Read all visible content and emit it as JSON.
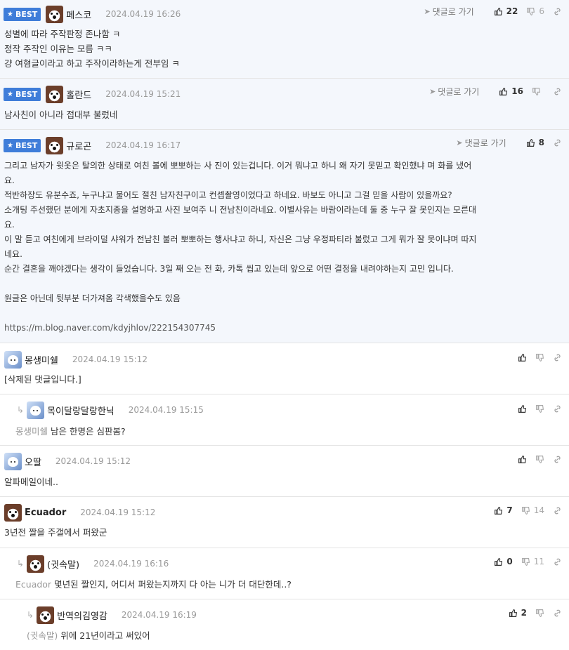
{
  "labels": {
    "best": "BEST",
    "reply_go": "댓글로 가기"
  },
  "comments": [
    {
      "nick": "페스코",
      "date": "2024.04.19 16:26",
      "up": "22",
      "down": "6",
      "lines": [
        "성별에 따라 주작판정 존나함 ㅋ",
        "정작 주작인 이유는 모름 ㅋㅋ",
        "걍 여혐글이라고 하고 주작이라하는게 전부임 ㅋ"
      ]
    },
    {
      "nick": "홀란드",
      "date": "2024.04.19 15:21",
      "up": "16",
      "down": "",
      "lines": [
        "남사친이 아니라 접대부 불렀네"
      ]
    },
    {
      "nick": "규로곤",
      "date": "2024.04.19 16:17",
      "up": "8",
      "down": "",
      "lines": [
        "그리고 남자가 윗옷은 탈의한 상태로 여친 볼에 뽀뽀하는 사 진이 있는겁니다. 이거 뭐냐고 하니 왜 자기 못믿고 확인했냐 며 화를 냈어",
        "요.",
        "적반하장도 유분수죠, 누구냐고 물어도 절친 남자친구이고 컨셉촬영이었다고 하네요. 바보도 아니고 그걸 믿을 사람이 있을까요?",
        "소개팅 주선했던 분에게 자초지종을 설명하고 사진 보여주 니 전남친이라네요. 이별사유는 바람이라는데 둘 중 누구 잘 못인지는 모른대",
        "요.",
        "이 말 듣고 여친에게 브라이덜 샤워가 전남친 불러 뽀뽀하는 행사냐고 하니, 자신은 그냥 우정파티라 불렀고 그게 뭐가 잘 못이냐며 따지",
        "네요.",
        "순간 결혼을 깨야겠다는 생각이 들었습니다. 3일 째 오는 전 화, 카톡 씹고 있는데 앞으로 어떤 결정을 내려야하는지 고민 입니다.",
        "",
        "원글은 아닌데 뒷부분 더가져옴 각색했을수도 있음",
        "",
        "https://m.blog.naver.com/kdyjhlov/222154307745"
      ]
    },
    {
      "nick": "몽생미쉘",
      "date": "2024.04.19 15:12",
      "up": "",
      "down": "",
      "mention": "",
      "text": "[삭제된 댓글입니다.]"
    },
    {
      "nick": "목이달랑달랑한닉",
      "date": "2024.04.19 15:15",
      "up": "",
      "down": "",
      "mention": "몽생미쉘",
      "text": "남은 한명은 심판봄?"
    },
    {
      "nick": "오딸",
      "date": "2024.04.19 15:12",
      "up": "",
      "down": "",
      "mention": "",
      "text": "알파메일이네.."
    },
    {
      "nick": "Ecuador",
      "date": "2024.04.19 15:12",
      "up": "7",
      "down": "14",
      "mention": "",
      "text": "3년전 짤을 주갤에서 퍼왔군"
    },
    {
      "nick": "(귓속말)",
      "date": "2024.04.19 16:16",
      "up": "0",
      "down": "11",
      "mention": "Ecuador",
      "text": "몇년된 짤인지, 어디서 퍼왔는지까지 다 아는 니가 더 대단한데..?"
    },
    {
      "nick": "반역의김영감",
      "date": "2024.04.19 16:19",
      "up": "2",
      "down": "",
      "mention": "(귓속말)",
      "text": "위에 21년이라고 써있어"
    }
  ]
}
